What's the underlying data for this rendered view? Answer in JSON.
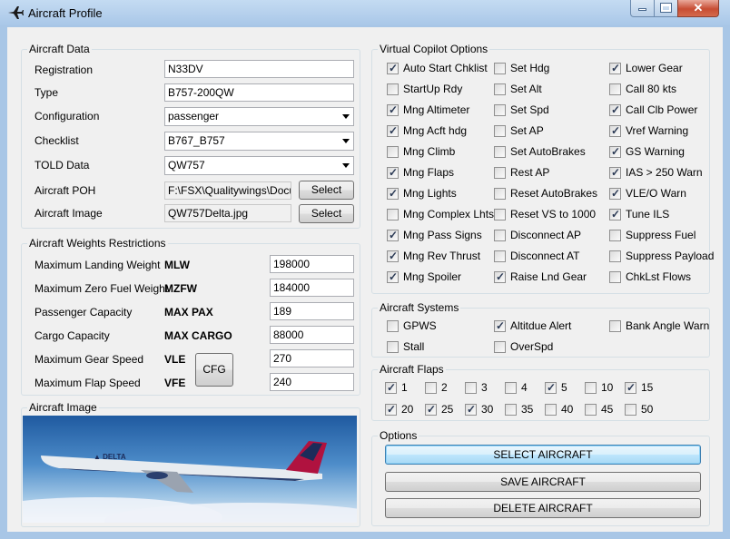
{
  "window": {
    "title": "Aircraft Profile"
  },
  "aircraft_data": {
    "title": "Aircraft Data",
    "registration": {
      "label": "Registration",
      "value": "N33DV"
    },
    "type": {
      "label": "Type",
      "value": "B757-200QW"
    },
    "configuration": {
      "label": "Configuration",
      "value": "passenger"
    },
    "checklist": {
      "label": "Checklist",
      "value": "B767_B757"
    },
    "told": {
      "label": "TOLD Data",
      "value": "QW757"
    },
    "poh": {
      "label": "Aircraft POH",
      "value": "F:\\FSX\\Qualitywings\\Docum",
      "button": "Select"
    },
    "image": {
      "label": "Aircraft Image",
      "value": "QW757Delta.jpg",
      "button": "Select"
    }
  },
  "weights": {
    "title": "Aircraft Weights  Restrictions",
    "rows": [
      {
        "label": "Maximum Landing Weight",
        "code": "MLW",
        "value": "198000"
      },
      {
        "label": "Maximum Zero Fuel Weight",
        "code": "MZFW",
        "value": "184000"
      },
      {
        "label": "Passenger Capacity",
        "code": "MAX PAX",
        "value": "189"
      },
      {
        "label": "Cargo Capacity",
        "code": "MAX CARGO",
        "value": "88000"
      },
      {
        "label": "Maximum Gear Speed",
        "code": "VLE",
        "value": "270"
      },
      {
        "label": "Maximum Flap Speed",
        "code": "VFE",
        "value": "240"
      }
    ],
    "cfg_button": "CFG"
  },
  "aircraft_image": {
    "title": "Aircraft Image"
  },
  "copilot": {
    "title": "Virtual Copilot Options",
    "col1": [
      {
        "label": "Auto Start Chklist",
        "checked": true
      },
      {
        "label": "StartUp Rdy",
        "checked": false
      },
      {
        "label": "Mng Altimeter",
        "checked": true
      },
      {
        "label": "Mng Acft hdg",
        "checked": true
      },
      {
        "label": "Mng Climb",
        "checked": false
      },
      {
        "label": "Mng Flaps",
        "checked": true
      },
      {
        "label": "Mng Lights",
        "checked": true
      },
      {
        "label": "Mng Complex Lhts",
        "checked": false
      },
      {
        "label": "Mng Pass Signs",
        "checked": true
      },
      {
        "label": "Mng Rev Thrust",
        "checked": true
      },
      {
        "label": "Mng Spoiler",
        "checked": true
      }
    ],
    "col2": [
      {
        "label": "Set Hdg",
        "checked": false
      },
      {
        "label": "Set Alt",
        "checked": false
      },
      {
        "label": "Set Spd",
        "checked": false
      },
      {
        "label": "Set AP",
        "checked": false
      },
      {
        "label": "Set AutoBrakes",
        "checked": false
      },
      {
        "label": "Rest AP",
        "checked": false
      },
      {
        "label": "Reset AutoBrakes",
        "checked": false
      },
      {
        "label": "Reset VS to 1000",
        "checked": false
      },
      {
        "label": "Disconnect AP",
        "checked": false
      },
      {
        "label": "Disconnect AT",
        "checked": false
      },
      {
        "label": "Raise Lnd Gear",
        "checked": true
      }
    ],
    "col3": [
      {
        "label": "Lower Gear",
        "checked": true
      },
      {
        "label": "Call 80 kts",
        "checked": false
      },
      {
        "label": "Call Clb Power",
        "checked": true
      },
      {
        "label": "Vref Warning",
        "checked": true
      },
      {
        "label": "GS Warning",
        "checked": true
      },
      {
        "label": "IAS > 250 Warn",
        "checked": true
      },
      {
        "label": "VLE/O Warn",
        "checked": true
      },
      {
        "label": "Tune ILS",
        "checked": true
      },
      {
        "label": "Suppress Fuel",
        "checked": false
      },
      {
        "label": "Suppress Payload",
        "checked": false
      },
      {
        "label": "ChkLst Flows",
        "checked": false
      }
    ]
  },
  "systems": {
    "title": "Aircraft Systems",
    "items": [
      {
        "label": "GPWS",
        "checked": false
      },
      {
        "label": "Altitdue Alert",
        "checked": true
      },
      {
        "label": "Bank Angle Warn",
        "checked": false
      },
      {
        "label": "Stall",
        "checked": false
      },
      {
        "label": "OverSpd",
        "checked": false
      }
    ]
  },
  "flaps": {
    "title": "Aircraft Flaps",
    "items": [
      {
        "label": "1",
        "checked": true
      },
      {
        "label": "2",
        "checked": false
      },
      {
        "label": "3",
        "checked": false
      },
      {
        "label": "4",
        "checked": false
      },
      {
        "label": "5",
        "checked": true
      },
      {
        "label": "10",
        "checked": false
      },
      {
        "label": "15",
        "checked": true
      },
      {
        "label": "20",
        "checked": true
      },
      {
        "label": "25",
        "checked": true
      },
      {
        "label": "30",
        "checked": true
      },
      {
        "label": "35",
        "checked": false
      },
      {
        "label": "40",
        "checked": false
      },
      {
        "label": "45",
        "checked": false
      },
      {
        "label": "50",
        "checked": false
      }
    ]
  },
  "options": {
    "title": "Options",
    "select": "SELECT AIRCRAFT",
    "save": "SAVE AIRCRAFT",
    "delete": "DELETE AIRCRAFT"
  },
  "icons": {
    "window": "airplane-icon",
    "minimize": "minimize-icon",
    "maximize": "maximize-icon",
    "close": "close-icon"
  },
  "colors": {
    "titlebar": "#a9c7e8",
    "client": "#f0f0f0",
    "close": "#c74d33",
    "focus_border": "#3c7fb1"
  }
}
